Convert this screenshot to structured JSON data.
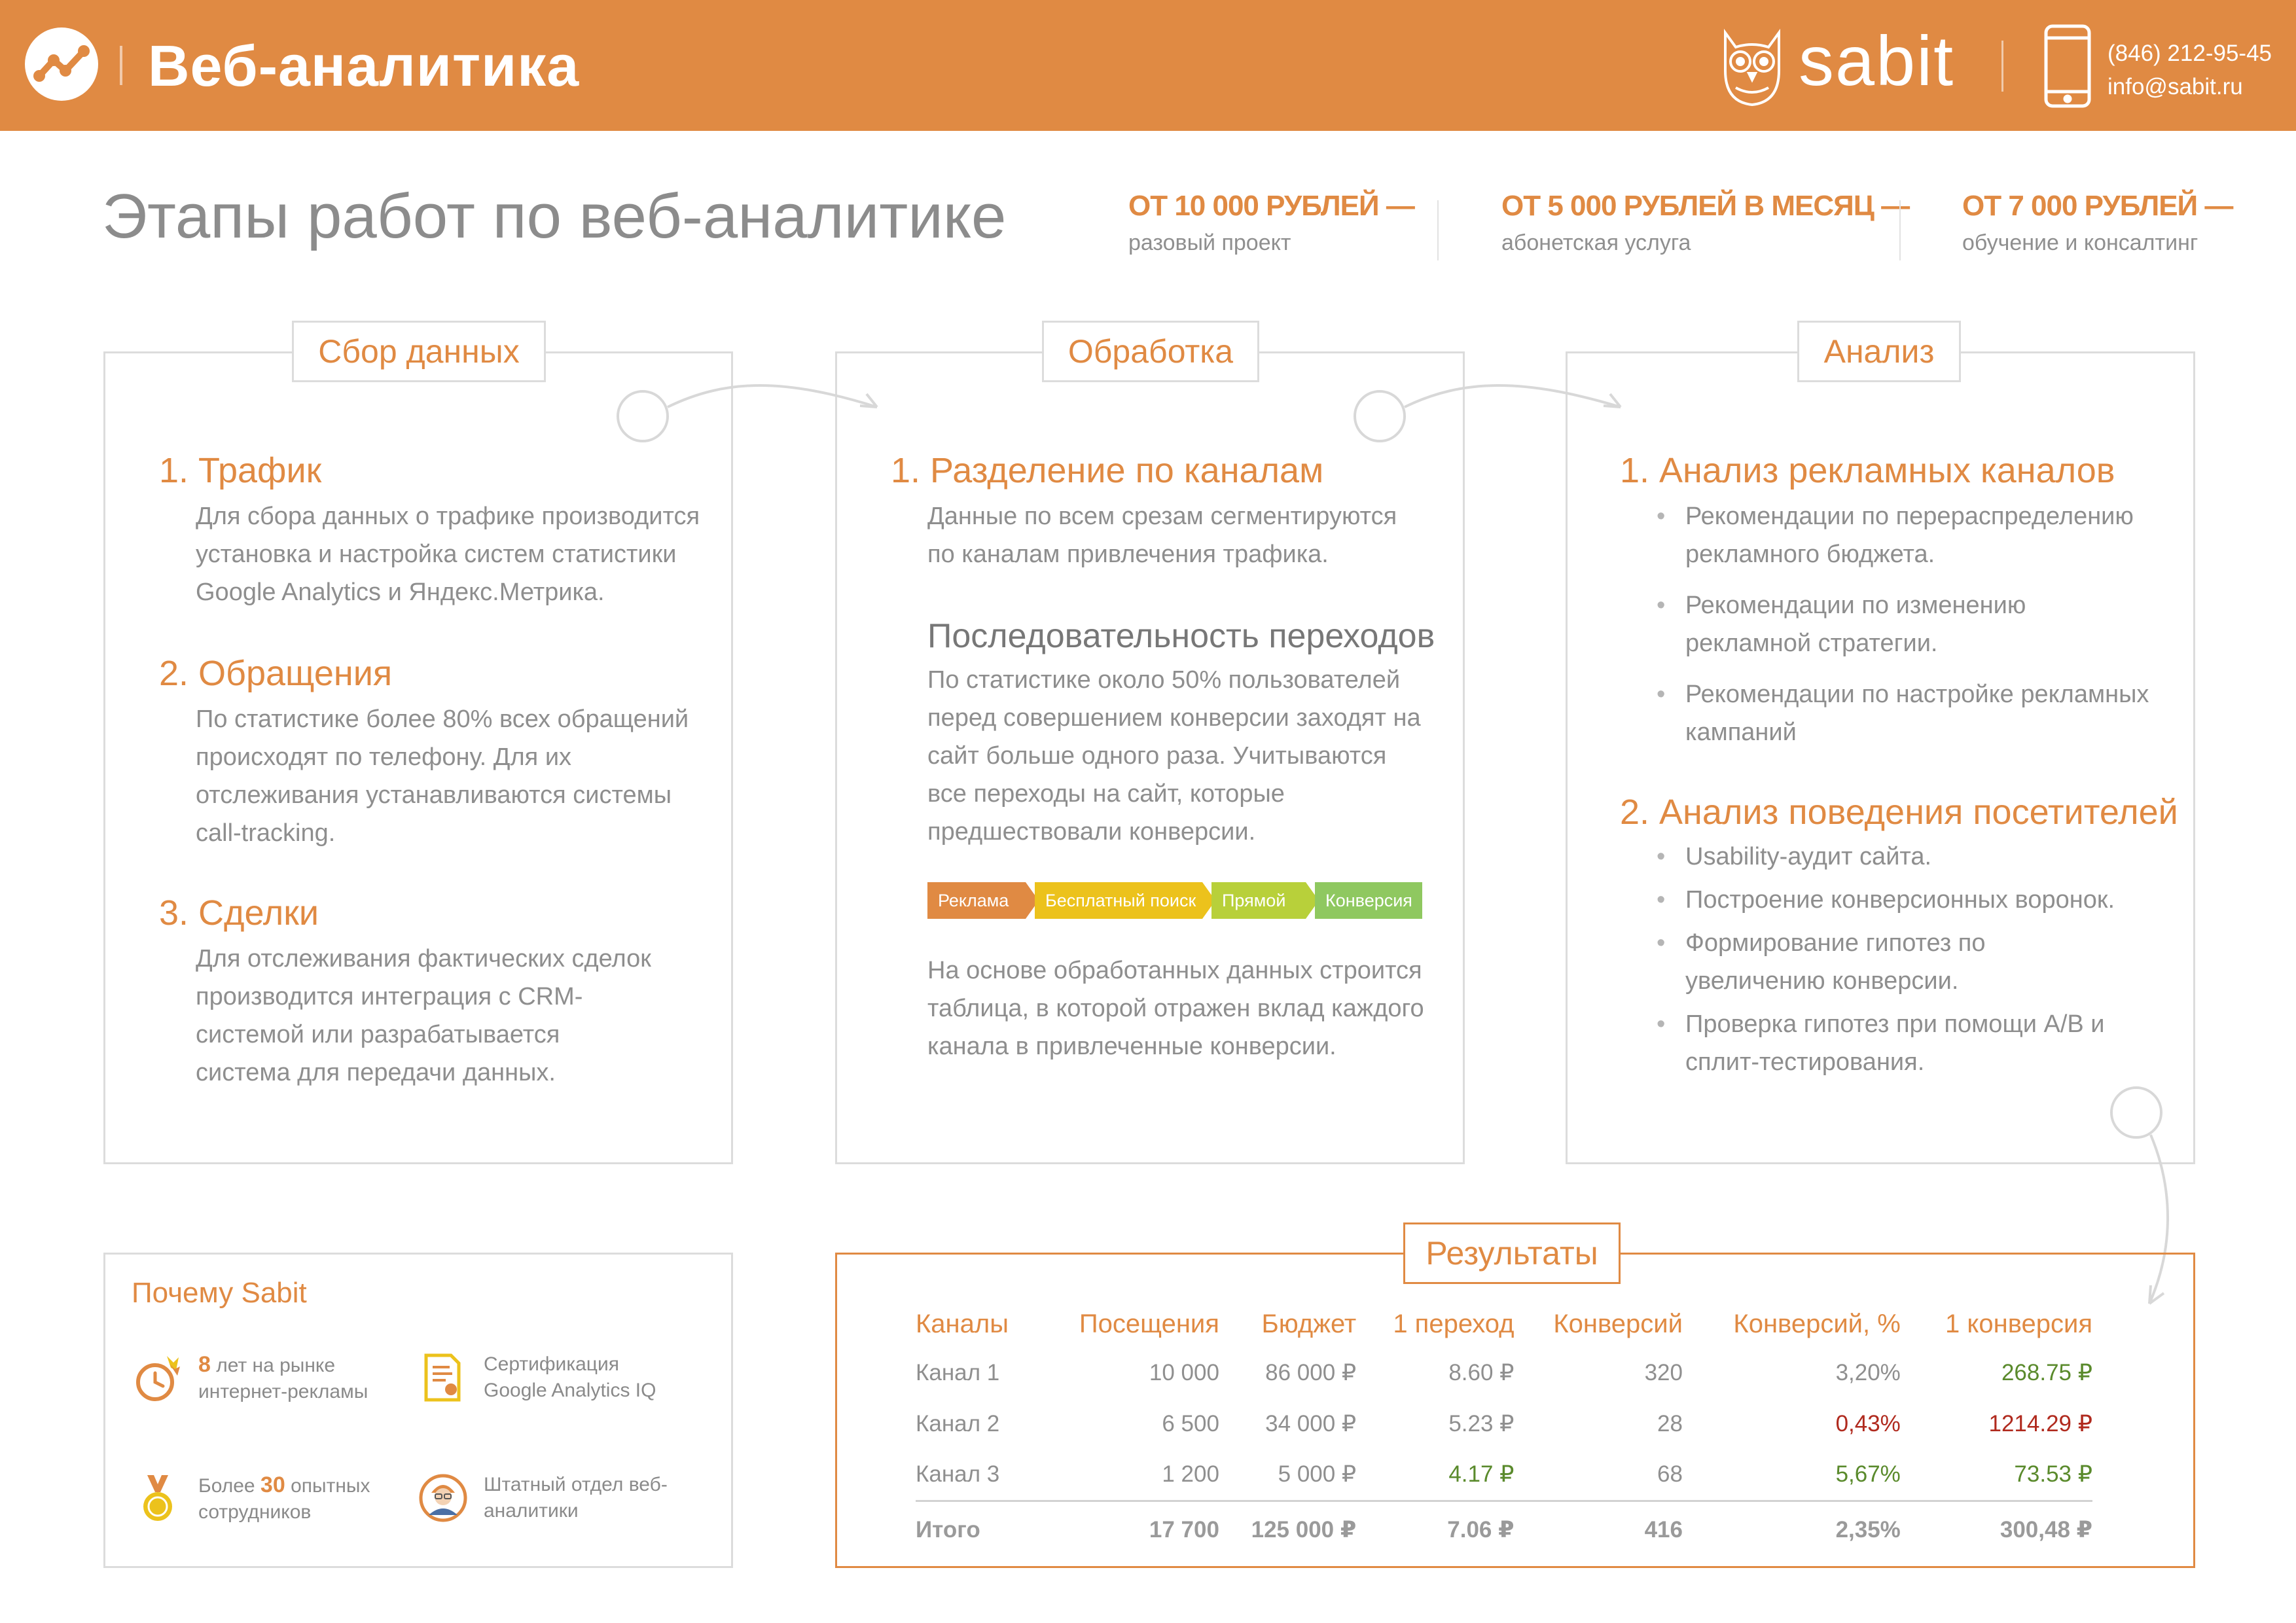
{
  "header": {
    "title": "Веб-аналитика",
    "brand": "sabit",
    "phone": "(846) 212-95-45",
    "email": "info@sabit.ru",
    "background_color": "#e08a43"
  },
  "page": {
    "title": "Этапы работ по веб-аналитике"
  },
  "prices": [
    {
      "amount": "ОТ 10 000 РУБЛЕЙ —",
      "note": "разовый проект"
    },
    {
      "amount": "ОТ 5 000 РУБЛЕЙ В МЕСЯЦ —",
      "note": "абонетская услуга"
    },
    {
      "amount": "ОТ 7 000 РУБЛЕЙ —",
      "note": "обучение и консалтинг"
    }
  ],
  "stages": {
    "collect": {
      "tab": "Сбор данных",
      "items": [
        {
          "heading": "1. Трафик",
          "text": "Для сбора данных о трафике производится установка и настройка систем статистики Google Analytics и Яндекс.Метрика."
        },
        {
          "heading": "2. Обращения",
          "text": "По статистике более 80% всех обращений происходят по телефону. Для их отслеживания устанавливаются системы call-tracking."
        },
        {
          "heading": "3. Сделки",
          "text": "Для отслеживания фактических сделок производится интеграция с CRM-системой или разрабатывается система для передачи данных."
        }
      ]
    },
    "process": {
      "tab": "Обработка",
      "heading": "1. Разделение по каналам",
      "text": "Данные по всем срезам сегментируются по каналам привлечения трафика.",
      "subheading": "Последовательность переходов",
      "subtext": "По статистике около 50% пользователей перед совершением конверсии заходят на сайт больше одного раза. Учитываются все переходы на сайт, которые предшествовали конверсии.",
      "flow": [
        {
          "label": "Реклама",
          "color": "#e08a43"
        },
        {
          "label": "Бесплатный поиск",
          "color": "#ecc21c"
        },
        {
          "label": "Прямой",
          "color": "#b8d03a"
        },
        {
          "label": "Конверсия",
          "color": "#8fc860"
        }
      ],
      "footer": "На основе обработанных данных строится таблица, в которой отражен вклад каждого канала в привлеченные конверсии."
    },
    "analysis": {
      "tab": "Анализ",
      "heading1": "1. Анализ рекламных каналов",
      "bullets1": [
        "Рекомендации по перераспределению рекламного бюджета.",
        "Рекомендации по изменению рекламной стратегии.",
        "Рекомендации по настройке рекламных кампаний"
      ],
      "heading2": "2. Анализ поведения посетителей",
      "bullets2": [
        "Usability-аудит сайта.",
        "Построение конверсионных воронок.",
        "Формирование гипотез по увеличению конверсии.",
        "Проверка гипотез при помощи A/B и сплит-тестирования."
      ]
    }
  },
  "why": {
    "title": "Почему Sabit",
    "items": [
      {
        "icon": "clock-icon",
        "num": "8",
        "pre": "",
        "post": " лет на рынке интернет-рекламы"
      },
      {
        "icon": "certificate-icon",
        "num": "",
        "pre": "Сертификация Google Analytics IQ",
        "post": ""
      },
      {
        "icon": "medal-icon",
        "num": "30",
        "pre": "Более ",
        "post": " опытных сотрудников"
      },
      {
        "icon": "analyst-icon",
        "num": "",
        "pre": "Штатный отдел веб-аналитики",
        "post": ""
      }
    ]
  },
  "results": {
    "tab": "Результаты",
    "columns": [
      "Каналы",
      "Посещения",
      "Бюджет",
      "1 переход",
      "Конверсий",
      "Конверсий, %",
      "1 конверсия"
    ],
    "rows": [
      [
        "Канал 1",
        "10 000",
        "86 000 ₽",
        "8.60 ₽",
        "320",
        "3,20%",
        "268.75 ₽"
      ],
      [
        "Канал 2",
        "6 500",
        "34 000 ₽",
        "5.23 ₽",
        "28",
        "0,43%",
        "1214.29 ₽"
      ],
      [
        "Канал 3",
        "1 200",
        "5 000 ₽",
        "4.17 ₽",
        "68",
        "5,67%",
        "73.53 ₽"
      ]
    ],
    "total": [
      "Итого",
      "17 700",
      "125 000 ₽",
      "7.06 ₽",
      "416",
      "2,35%",
      "300,48 ₽"
    ],
    "highlight": {
      "good_color": "#5a8a2c",
      "bad_color": "#b02a1e",
      "good_cells": [
        "2.3",
        "0.6",
        "2.6",
        "2.5"
      ],
      "bad_cells": [
        "1.5",
        "1.6"
      ]
    }
  }
}
